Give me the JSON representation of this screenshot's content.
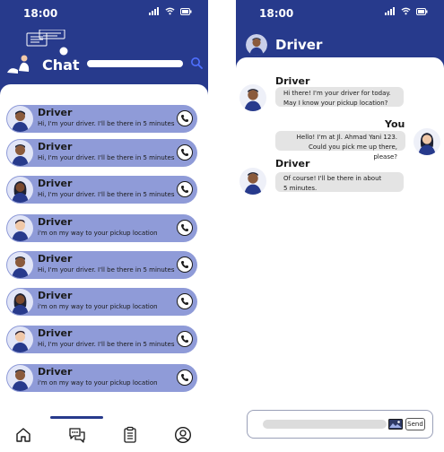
{
  "status_bar": {
    "time": "18:00"
  },
  "chat_list": {
    "title": "Chat",
    "search": {
      "value": "",
      "placeholder": ""
    },
    "contacts": [
      {
        "name": "Driver",
        "message": "Hi, I'm your driver. I'll be there in 5 minutes"
      },
      {
        "name": "Driver",
        "message": "Hi, I'm your driver. I'll be there in 5 minutes"
      },
      {
        "name": "Driver",
        "message": "Hi, I'm your driver. I'll be there in 5 minutes"
      },
      {
        "name": "Driver",
        "message": "i'm on my way to your pickup location"
      },
      {
        "name": "Driver",
        "message": "Hi, I'm your driver. I'll be there in 5 minutes"
      },
      {
        "name": "Driver",
        "message": "i'm on my way to your pickup location"
      },
      {
        "name": "Driver",
        "message": "Hi, I'm your driver. I'll be there in 5 minutes"
      },
      {
        "name": "Driver",
        "message": "i'm on my way to your pickup location"
      }
    ],
    "nav": [
      "home-icon",
      "chat-bubbles-icon",
      "clipboard-icon",
      "profile-icon"
    ],
    "active_nav": "chat-bubbles-icon"
  },
  "conversation": {
    "header_name": "Driver",
    "messages": [
      {
        "sender": "Driver",
        "lines": [
          "Hi there! I'm your driver for today.",
          "May I know your pickup location?"
        ]
      },
      {
        "sender": "You",
        "lines": [
          "Hello! I'm at Jl. Ahmad Yani 123.",
          "Could you pick me up there, please?"
        ]
      },
      {
        "sender": "Driver",
        "lines": [
          "Of course! I'll be there in about",
          "5 minutes."
        ]
      }
    ],
    "compose": {
      "value": "",
      "placeholder": "",
      "send_label": "Send"
    }
  },
  "colors": {
    "primary": "#273a8c",
    "row_background": "#8f9bd8",
    "bubble": "#e4e4e4"
  }
}
